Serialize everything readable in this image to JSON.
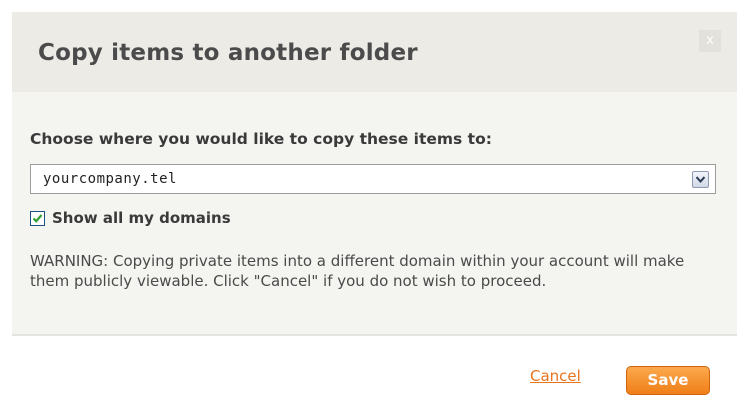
{
  "dialog": {
    "title": "Copy items to another folder",
    "close_label": "x"
  },
  "form": {
    "prompt": "Choose where you would like to copy these items to:",
    "destination": {
      "selected": "yourcompany.tel"
    },
    "show_all_domains": {
      "label": "Show all my domains",
      "checked": true
    },
    "warning": "WARNING: Copying private items into a different domain within your account will make them publicly viewable. Click \"Cancel\" if you do not wish to proceed."
  },
  "actions": {
    "cancel_label": "Cancel",
    "save_label": "Save"
  },
  "colors": {
    "header_bg": "#ecebe6",
    "body_bg": "#f4f4f1",
    "accent_orange": "#f07f17",
    "link_orange": "#e8741e",
    "checkbox_check": "#2f9e2f"
  },
  "icons": {
    "dropdown": "chevron-down-icon",
    "check": "checkmark-icon"
  }
}
